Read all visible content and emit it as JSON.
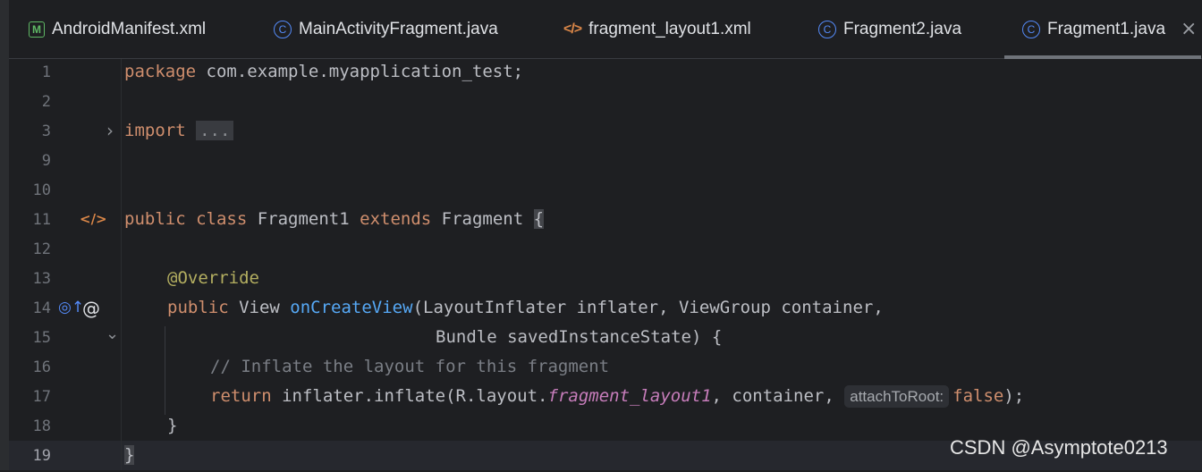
{
  "tabs": [
    {
      "label": "AndroidManifest.xml",
      "icon": "manifest-icon",
      "icon_char": "M",
      "active": false
    },
    {
      "label": "MainActivityFragment.java",
      "icon": "java-class-icon",
      "icon_char": "C",
      "active": false
    },
    {
      "label": "fragment_layout1.xml",
      "icon": "xml-layout-icon",
      "icon_char": "</>",
      "active": false
    },
    {
      "label": "Fragment2.java",
      "icon": "java-class-icon",
      "icon_char": "C",
      "active": false
    },
    {
      "label": "Fragment1.java",
      "icon": "java-class-icon",
      "icon_char": "C",
      "active": true
    }
  ],
  "close_glyph": "×",
  "line_numbers": [
    "1",
    "2",
    "3",
    "9",
    "10",
    "11",
    "12",
    "13",
    "14",
    "15",
    "16",
    "17",
    "18",
    "19"
  ],
  "code": {
    "l1_kw": "package",
    "l1_rest": " com.example.myapplication_test;",
    "l3_kw": "import",
    "l3_fold": "...",
    "l11_kw1": "public",
    "l11_kw2": "class",
    "l11_name": " Fragment1 ",
    "l11_kw3": "extends",
    "l11_sup": " Fragment ",
    "l11_brace": "{",
    "l13_ann": "@Override",
    "l14_kw": "public",
    "l14_type": " View ",
    "l14_fn": "onCreateView",
    "l14_rest": "(LayoutInflater inflater, ViewGroup container,",
    "l15": "Bundle savedInstanceState) {",
    "l16": "// Inflate the layout for this fragment",
    "l17_kw": "return",
    "l17_a": " inflater.inflate(R.layout.",
    "l17_it": "fragment_layout1",
    "l17_b": ", container, ",
    "l17_hint": "attachToRoot:",
    "l17_false": "false",
    "l17_end": ");",
    "l18": "}",
    "l19": "}"
  },
  "gutter": {
    "fold_expand": "›",
    "fold_collapse": "⌄",
    "xml_marker": "</>",
    "override_marker": "◎↑",
    "at_marker": "@"
  },
  "watermark": "CSDN @Asymptote0213"
}
